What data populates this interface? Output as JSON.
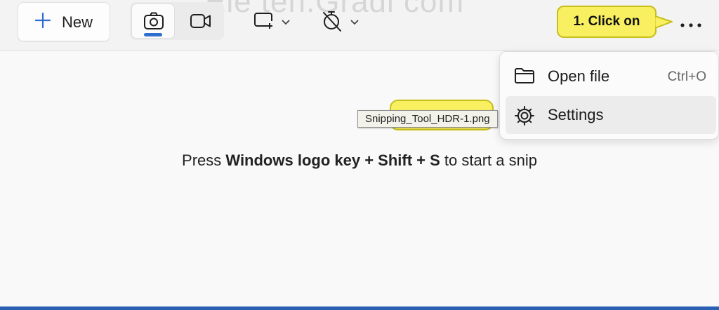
{
  "toolbar": {
    "watermark_text": "Ele ten.Gradi com",
    "new_label": "New",
    "more_icon": "more-horizontal-icon",
    "icons": {
      "photo": "camera-icon",
      "video": "video-icon",
      "shape": "rectangle-snip-icon",
      "delay": "timer-off-icon"
    }
  },
  "callout": {
    "text": "1. Click on"
  },
  "menu": {
    "items": [
      {
        "label": "Open file",
        "shortcut": "Ctrl+O",
        "icon": "folder-icon"
      },
      {
        "label": "Settings",
        "shortcut": "",
        "icon": "gear-icon"
      }
    ]
  },
  "tooltip": {
    "text": "Snipping_Tool_HDR-1.png"
  },
  "hint": {
    "prefix": "Press ",
    "keys": "Windows logo key + Shift + S",
    "suffix": " to start a snip"
  },
  "colors": {
    "accent": "#2f6ecf",
    "callout_fill": "#f8f060",
    "callout_border": "#c7bf1b"
  }
}
